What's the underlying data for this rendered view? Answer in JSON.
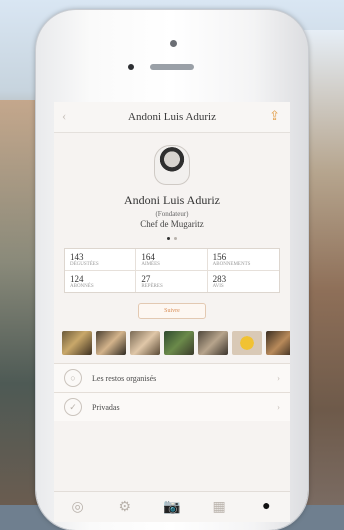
{
  "nav": {
    "title": "Andoni Luis Aduriz"
  },
  "profile": {
    "name": "Andoni Luis Aduriz",
    "role": "(Fondateur)",
    "title": "Chef de Mugaritz"
  },
  "stats": [
    {
      "value": "143",
      "label": "Dégustées"
    },
    {
      "value": "164",
      "label": "Aimées"
    },
    {
      "value": "156",
      "label": "Abonnements"
    },
    {
      "value": "124",
      "label": "Abonnés"
    },
    {
      "value": "27",
      "label": "Repères"
    },
    {
      "value": "283",
      "label": "Avis"
    }
  ],
  "follow": {
    "label": "Suivre"
  },
  "list": [
    {
      "label": "Les restos organisés"
    },
    {
      "label": "Privadas"
    }
  ],
  "colors": {
    "accent": "#e58a3b",
    "bg": "#f6f3f1"
  }
}
